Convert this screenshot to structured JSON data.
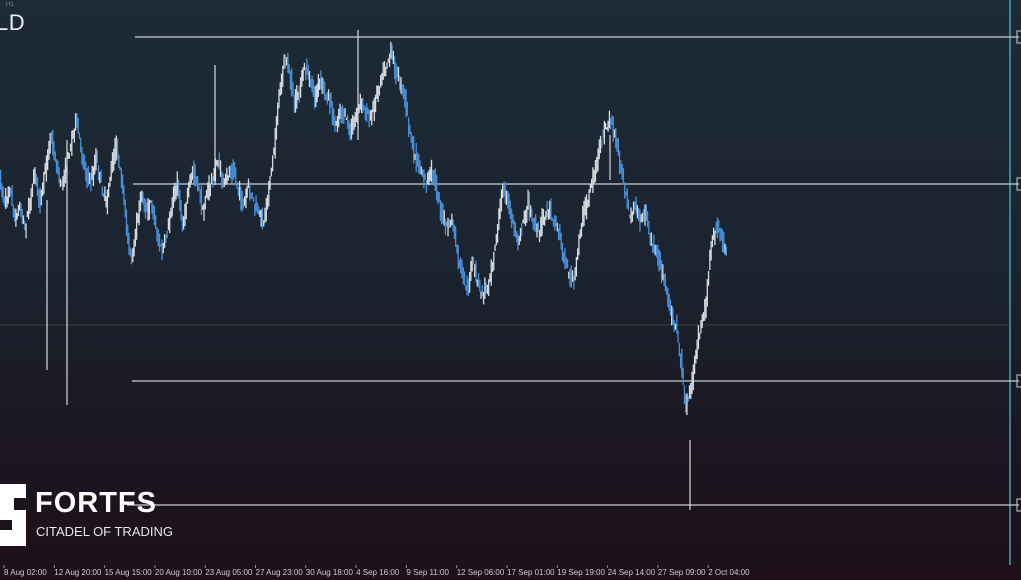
{
  "header": {
    "symbol": "LD",
    "period": "H1"
  },
  "logo": {
    "brand": "FORTFS",
    "tagline": "CITADEL OF TRADING"
  },
  "colors": {
    "up_candle": "#d8dce0",
    "down_candle": "#4a90d9",
    "level_line": "#c9cdd1",
    "vertical_marker": "#3fa3b4",
    "axis_text": "#c9cfd4"
  },
  "chart_data": {
    "type": "line",
    "title": "",
    "x_tick_labels": [
      "8 Aug 02:00",
      "12 Aug 20:00",
      "15 Aug 15:00",
      "20 Aug 10:00",
      "23 Aug 05:00",
      "27 Aug 23:00",
      "30 Aug 18:00",
      "4 Sep 16:00",
      "9 Sep 11:00",
      "12 Sep 06:00",
      "17 Sep 01:00",
      "19 Sep 19:00",
      "24 Sep 14:00",
      "27 Sep 09:00",
      "2 Oct 04:00"
    ],
    "levels": [
      "upper",
      "middle",
      "lower",
      "bottom"
    ],
    "series": [
      {
        "values": [
          0.72,
          0.66,
          0.7,
          0.62,
          0.65,
          0.6,
          0.67,
          0.73,
          0.66,
          0.74,
          0.82,
          0.76,
          0.7,
          0.74,
          0.8,
          0.86,
          0.79,
          0.73,
          0.71,
          0.77,
          0.7,
          0.66,
          0.74,
          0.8,
          0.71,
          0.6,
          0.52,
          0.61,
          0.68,
          0.64,
          0.66,
          0.58,
          0.54,
          0.59,
          0.66,
          0.71,
          0.6,
          0.68,
          0.74,
          0.7,
          0.64,
          0.69,
          0.72,
          0.76,
          0.7,
          0.73,
          0.74,
          0.69,
          0.65,
          0.7,
          0.66,
          0.63,
          0.62,
          0.7,
          0.79,
          0.92,
          1.0,
          0.97,
          0.89,
          0.93,
          0.98,
          0.96,
          0.91,
          0.95,
          0.92,
          0.9,
          0.84,
          0.88,
          0.86,
          0.83,
          0.86,
          0.9,
          0.88,
          0.86,
          0.91,
          0.96,
          0.99,
          1.02,
          0.97,
          0.94,
          0.89,
          0.8,
          0.76,
          0.73,
          0.71,
          0.74,
          0.69,
          0.63,
          0.6,
          0.62,
          0.54,
          0.49,
          0.45,
          0.52,
          0.47,
          0.44,
          0.47,
          0.52,
          0.6,
          0.7,
          0.66,
          0.61,
          0.57,
          0.62,
          0.66,
          0.61,
          0.58,
          0.63,
          0.65,
          0.62,
          0.59,
          0.53,
          0.49,
          0.47,
          0.58,
          0.64,
          0.68,
          0.73,
          0.79,
          0.83,
          0.86,
          0.82,
          0.76,
          0.69,
          0.62,
          0.65,
          0.62,
          0.63,
          0.57,
          0.55,
          0.51,
          0.46,
          0.4,
          0.37,
          0.28,
          0.17,
          0.22,
          0.31,
          0.37,
          0.43,
          0.56,
          0.6,
          0.58,
          0.54
        ]
      }
    ]
  }
}
